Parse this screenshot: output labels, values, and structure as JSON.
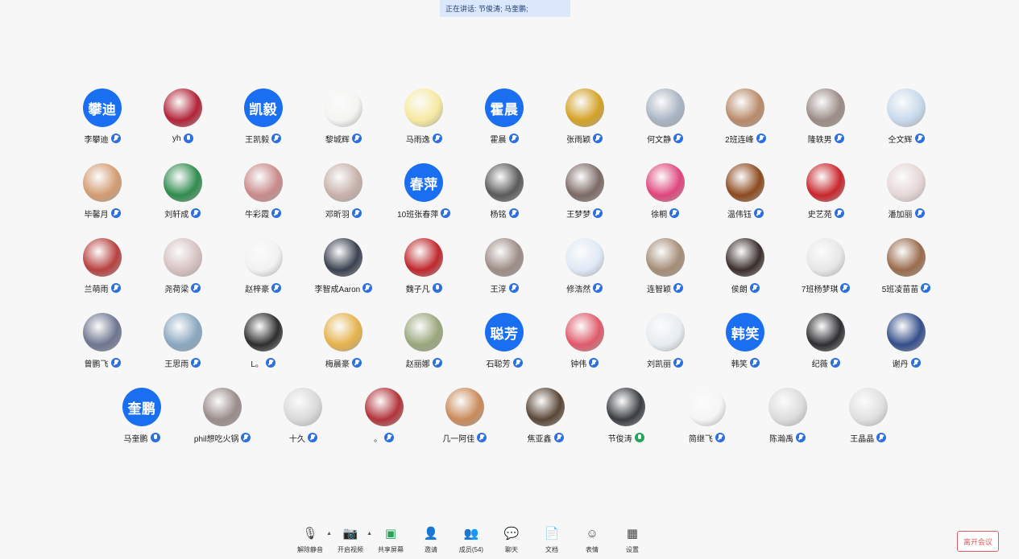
{
  "speaking": {
    "text": "正在讲话: 节俊涛; 马奎鹏;"
  },
  "rows": [
    [
      {
        "name": "李攀迪",
        "avatar_text": "攀迪",
        "mic": "muted"
      },
      {
        "name": "yh",
        "mic": "normal",
        "avatar_color": "#b22338"
      },
      {
        "name": "王凯毅",
        "avatar_text": "凯毅",
        "mic": "muted"
      },
      {
        "name": "黎城辉",
        "mic": "muted",
        "avatar_color": "#f4f4f2"
      },
      {
        "name": "马雨逸",
        "mic": "muted",
        "avatar_color": "#f7e9a0"
      },
      {
        "name": "霍晨",
        "avatar_text": "霍晨",
        "mic": "muted"
      },
      {
        "name": "张雨颖",
        "mic": "muted",
        "avatar_color": "#d4a227"
      },
      {
        "name": "何文静",
        "mic": "muted",
        "avatar_color": "#a9b4c4"
      },
      {
        "name": "2班连峰",
        "mic": "muted",
        "avatar_color": "#b98a6a"
      },
      {
        "name": "隆轶男",
        "mic": "muted",
        "avatar_color": "#9b8b85"
      },
      {
        "name": "仝文辉",
        "mic": "muted",
        "avatar_color": "#c7d9ec"
      }
    ],
    [
      {
        "name": "毕馨月",
        "mic": "muted",
        "avatar_color": "#d39c72"
      },
      {
        "name": "刘轩成",
        "mic": "muted",
        "avatar_color": "#2f8c4f"
      },
      {
        "name": "牛彩霞",
        "mic": "muted",
        "avatar_color": "#c98a8a"
      },
      {
        "name": "邓昕羽",
        "mic": "muted",
        "avatar_color": "#c7b1aa"
      },
      {
        "name": "10班张春萍",
        "avatar_text": "春萍",
        "mic": "muted"
      },
      {
        "name": "杨铭",
        "mic": "muted",
        "avatar_color": "#5a5a5a"
      },
      {
        "name": "王梦梦",
        "mic": "muted",
        "avatar_color": "#7c6a66"
      },
      {
        "name": "徐桐",
        "mic": "muted",
        "avatar_color": "#e0467c"
      },
      {
        "name": "温伟钰",
        "mic": "muted",
        "avatar_color": "#8d4a1f"
      },
      {
        "name": "史艺苑",
        "mic": "muted",
        "avatar_color": "#c9262c"
      },
      {
        "name": "潘加丽",
        "mic": "muted",
        "avatar_color": "#e6d6d6"
      }
    ],
    [
      {
        "name": "兰萌雨",
        "mic": "muted",
        "avatar_color": "#b7413f"
      },
      {
        "name": "尧荷梁",
        "mic": "muted",
        "avatar_color": "#d7c1c1"
      },
      {
        "name": "赵梓豪",
        "mic": "muted",
        "avatar_color": "#f2f2f2"
      },
      {
        "name": "李智成Aaron",
        "mic": "muted",
        "avatar_color": "#3a4150"
      },
      {
        "name": "魏子凡",
        "mic": "normal",
        "avatar_color": "#c0282d"
      },
      {
        "name": "王淳",
        "mic": "muted",
        "avatar_color": "#9e8c86"
      },
      {
        "name": "修浩然",
        "mic": "muted",
        "avatar_color": "#dfe9f5"
      },
      {
        "name": "连智颖",
        "mic": "muted",
        "avatar_color": "#a58d77"
      },
      {
        "name": "侯朗",
        "mic": "muted",
        "avatar_color": "#3b2f2d"
      },
      {
        "name": "7班杨梦琪",
        "mic": "muted",
        "avatar_color": "#e7e7e7"
      },
      {
        "name": "5班凌苗苗",
        "mic": "muted",
        "avatar_color": "#9a6b4d"
      }
    ],
    [
      {
        "name": "曾鹏飞",
        "mic": "muted",
        "avatar_color": "#6d7590"
      },
      {
        "name": "王思雨",
        "mic": "muted",
        "avatar_color": "#8aa7c0"
      },
      {
        "name": "L。",
        "mic": "muted",
        "avatar_color": "#2e2e2e"
      },
      {
        "name": "梅晨豪",
        "mic": "muted",
        "avatar_color": "#e6b24c"
      },
      {
        "name": "赵丽娜",
        "mic": "muted",
        "avatar_color": "#9aa77c"
      },
      {
        "name": "石聪芳",
        "avatar_text": "聪芳",
        "mic": "muted"
      },
      {
        "name": "钟伟",
        "mic": "muted",
        "avatar_color": "#e05a6b"
      },
      {
        "name": "刘凯丽",
        "mic": "muted",
        "avatar_color": "#e7ecf1"
      },
      {
        "name": "韩笑",
        "avatar_text": "韩笑",
        "mic": "muted"
      },
      {
        "name": "纪薇",
        "mic": "muted",
        "avatar_color": "#2f2f33"
      },
      {
        "name": "谢丹",
        "mic": "muted",
        "avatar_color": "#344e8a"
      }
    ],
    [
      {
        "name": "马奎鹏",
        "avatar_text": "奎鹏",
        "mic": "normal"
      },
      {
        "name": "phil想吃火锅",
        "mic": "muted",
        "avatar_color": "#9a8c8a"
      },
      {
        "name": "十久",
        "mic": "muted",
        "avatar_color": "#d9d9d9"
      },
      {
        "name": "。",
        "mic": "muted",
        "avatar_color": "#b2343a"
      },
      {
        "name": "几一阿佳",
        "mic": "muted",
        "avatar_color": "#c98a5a"
      },
      {
        "name": "焦亚鑫",
        "mic": "muted",
        "avatar_color": "#5a4636"
      },
      {
        "name": "节俊涛",
        "mic": "talking",
        "avatar_color": "#3a3d42"
      },
      {
        "name": "简继飞",
        "mic": "muted",
        "avatar_color": "#f5f5f5"
      },
      {
        "name": "陈瀚禹",
        "mic": "muted",
        "avatar_color": "#dcdcdc"
      },
      {
        "name": "王晶晶",
        "mic": "muted",
        "avatar_color": "#e0e0e0"
      }
    ]
  ],
  "toolbar": {
    "items": [
      {
        "key": "unmute",
        "label": "解除静音",
        "icon": "mic-off-icon",
        "glyph": "🎙",
        "caret": true,
        "color": "#444"
      },
      {
        "key": "video",
        "label": "开启视频",
        "icon": "camera-off-icon",
        "glyph": "📷",
        "caret": true,
        "color": "#444"
      },
      {
        "key": "share",
        "label": "共享屏幕",
        "icon": "screen-share-icon",
        "glyph": "▣",
        "caret": false,
        "color": "#27a35a"
      },
      {
        "key": "invite",
        "label": "邀请",
        "icon": "invite-icon",
        "glyph": "👤",
        "caret": false,
        "color": "#444"
      },
      {
        "key": "members",
        "label": "成员(54)",
        "icon": "members-icon",
        "glyph": "👥",
        "caret": false,
        "color": "#444"
      },
      {
        "key": "chat",
        "label": "聊天",
        "icon": "chat-icon",
        "glyph": "💬",
        "caret": false,
        "color": "#444"
      },
      {
        "key": "docs",
        "label": "文档",
        "icon": "document-icon",
        "glyph": "📄",
        "caret": false,
        "color": "#444"
      },
      {
        "key": "emoji",
        "label": "表情",
        "icon": "emoji-icon",
        "glyph": "☺",
        "caret": false,
        "color": "#444"
      },
      {
        "key": "settings",
        "label": "设置",
        "icon": "settings-icon",
        "glyph": "▦",
        "caret": false,
        "color": "#444"
      }
    ],
    "caret_glyph": "▲"
  },
  "leave": {
    "label": "离开会议"
  }
}
